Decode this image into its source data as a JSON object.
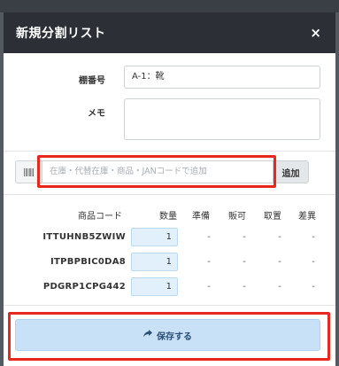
{
  "modal": {
    "title": "新規分割リスト",
    "close_glyph": "×"
  },
  "form": {
    "shelf_label": "棚番号",
    "shelf_value": "A-1：靴",
    "memo_label": "メモ",
    "memo_value": ""
  },
  "scan": {
    "placeholder": "在庫・代替在庫・商品・JANコードで追加",
    "add_label": "追加",
    "barcode_icon": "barcode-icon"
  },
  "table": {
    "headers": {
      "code": "商品コード",
      "qty": "数量",
      "prep": "準備",
      "sellable": "販可",
      "cancel": "取置",
      "diff": "差異"
    },
    "rows": [
      {
        "code": "ITTUHNB5ZWIW",
        "qty": "1",
        "prep": "-",
        "sellable": "-",
        "cancel": "-",
        "diff": "-"
      },
      {
        "code": "ITPBPBIC0DA8",
        "qty": "1",
        "prep": "-",
        "sellable": "-",
        "cancel": "-",
        "diff": "-"
      },
      {
        "code": "PDGRP1CPG442",
        "qty": "1",
        "prep": "-",
        "sellable": "-",
        "cancel": "-",
        "diff": "-"
      }
    ]
  },
  "save": {
    "label": "保存する",
    "icon": "share-arrow-icon"
  },
  "colors": {
    "header_bg": "#2c3036",
    "highlight": "#e8281e",
    "save_bg": "#c9e1f6",
    "qty_bg": "#e1f0fb"
  }
}
